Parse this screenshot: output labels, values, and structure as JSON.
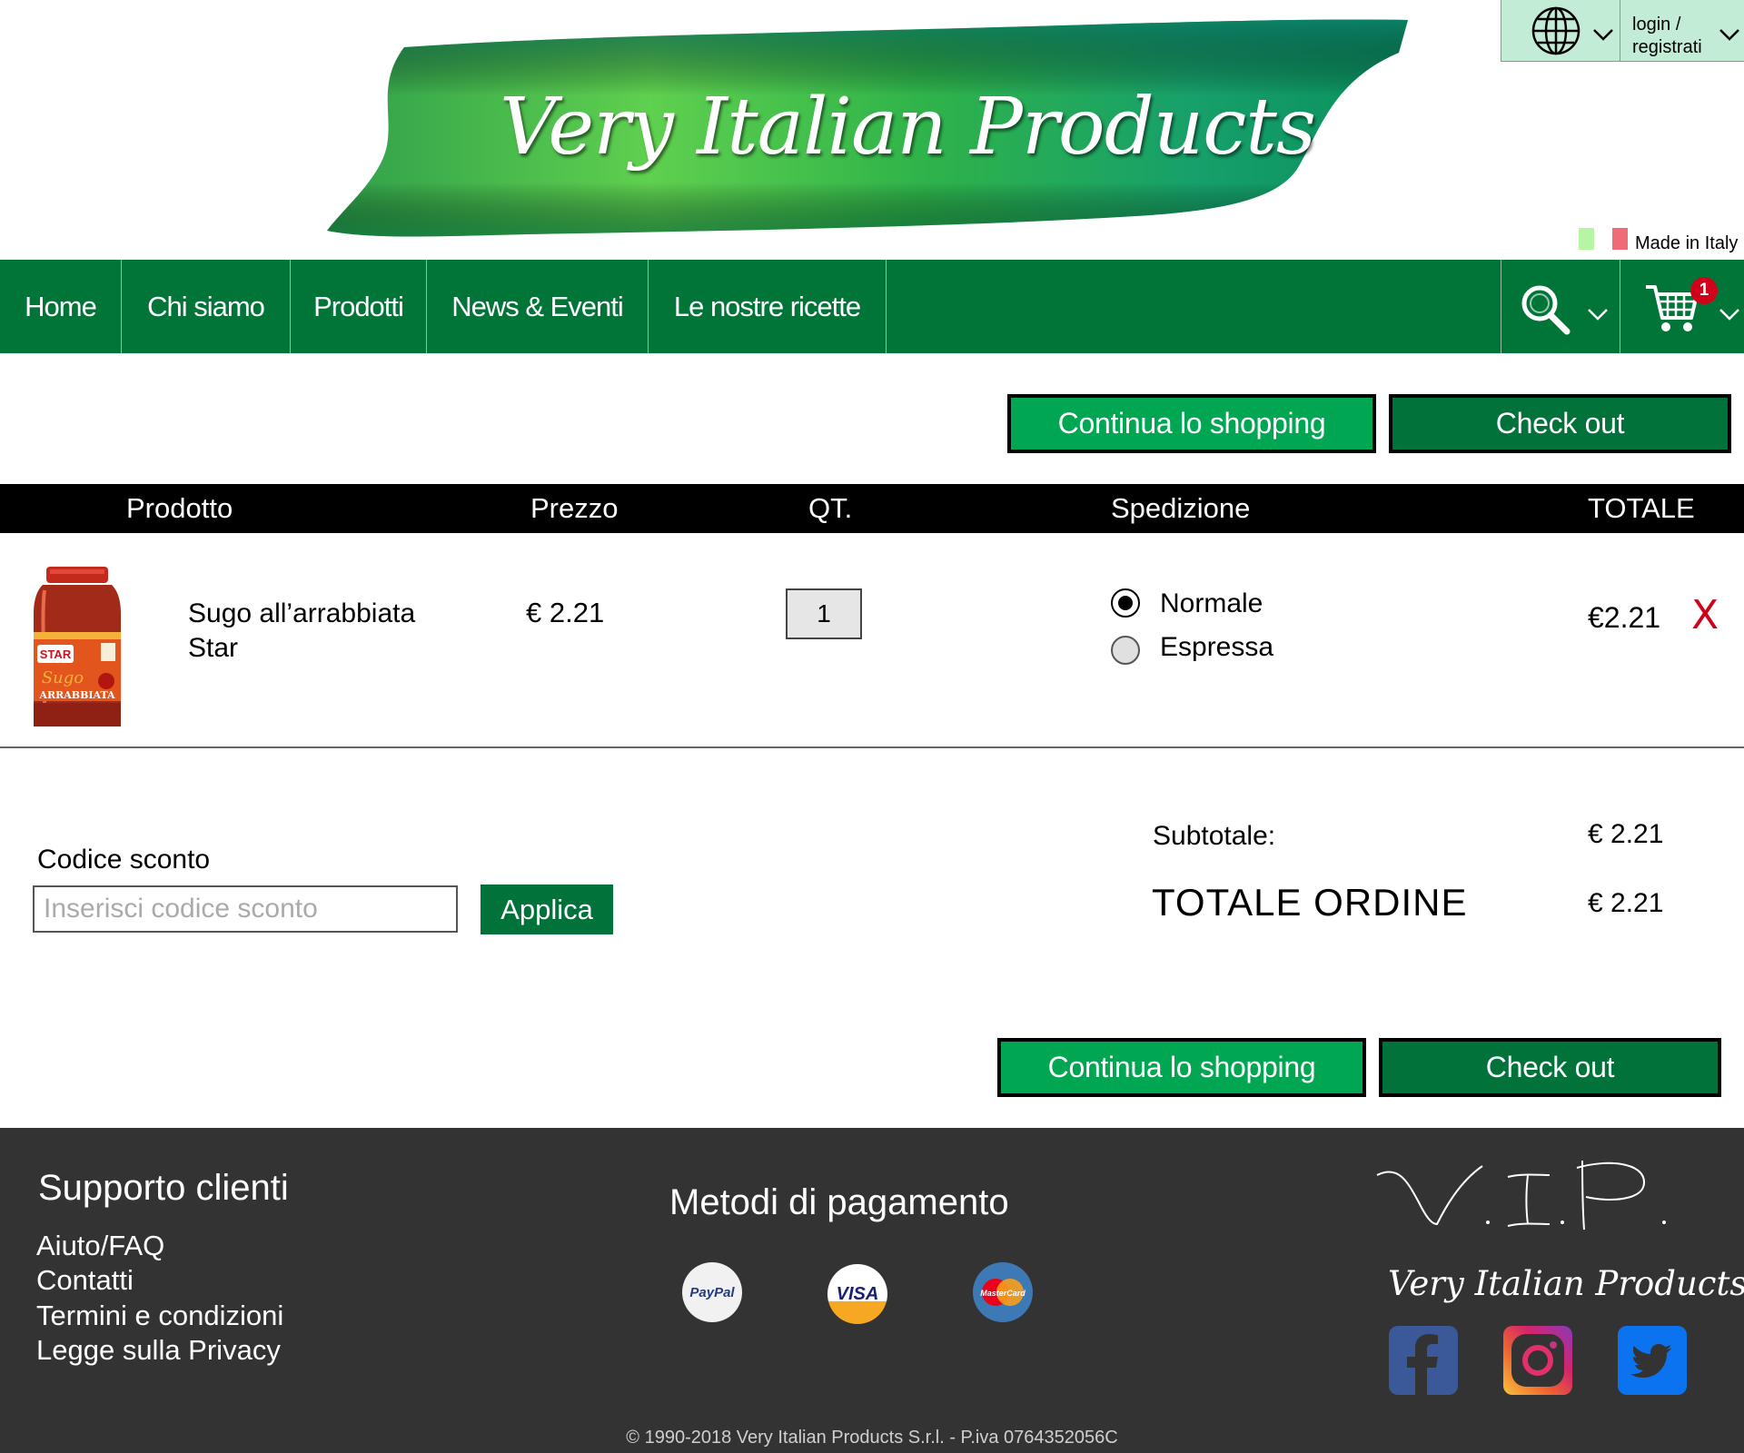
{
  "brand": {
    "logo_text": "Very Italian Products",
    "made_in": "Made in Italy",
    "colors": {
      "nav_green": "#017538",
      "button_light": "#00a651",
      "button_dark": "#01723a",
      "footer_bg": "#333333",
      "flag_green": "#b6f5a4",
      "flag_red": "#f06b78"
    }
  },
  "topbar": {
    "language_icon": "globe-icon",
    "login_label": "login / registrati"
  },
  "nav": {
    "items": [
      {
        "label": "Home"
      },
      {
        "label": "Chi siamo"
      },
      {
        "label": "Prodotti"
      },
      {
        "label": "News & Eventi"
      },
      {
        "label": "Le nostre ricette"
      }
    ],
    "search_icon": "search-icon",
    "cart_icon": "cart-icon",
    "cart_count": "1"
  },
  "actions": {
    "continue_label": "Continua lo shopping",
    "checkout_label": "Check out"
  },
  "cart_table": {
    "headers": {
      "product": "Prodotto",
      "price": "Prezzo",
      "qty": "QT.",
      "shipping": "Spedizione",
      "total": "TOTALE"
    },
    "rows": [
      {
        "product_name": "Sugo all’arrabbiata Star",
        "product_image_labels": {
          "brand": "STAR",
          "line": "Sugo",
          "variant": "ARRABBIATA"
        },
        "price": "€ 2.21",
        "qty": "1",
        "shipping_options": [
          {
            "label": "Normale",
            "selected": true
          },
          {
            "label": "Espressa",
            "selected": false
          }
        ],
        "total": "€2.21",
        "remove_label": "X"
      }
    ]
  },
  "discount": {
    "label": "Codice sconto",
    "placeholder": "Inserisci codice sconto",
    "value": "",
    "apply_label": "Applica"
  },
  "summary": {
    "subtotal_label": "Subtotale:",
    "subtotal_value": "€ 2.21",
    "total_label": "TOTALE ORDINE",
    "total_value": "€ 2.21"
  },
  "footer": {
    "support_title": "Supporto clienti",
    "support_links": [
      "Aiuto/FAQ",
      "Contatti",
      "Termini e condizioni",
      "Legge sulla Privacy"
    ],
    "payments_title": "Metodi di pagamento",
    "payment_methods": [
      {
        "name": "PayPal",
        "icon": "paypal-icon"
      },
      {
        "name": "VISA",
        "icon": "visa-icon"
      },
      {
        "name": "MasterCard",
        "icon": "mastercard-icon"
      }
    ],
    "vip_mark": "V.I.P.",
    "brand_name": "Very Italian Products",
    "social": [
      "facebook-icon",
      "instagram-icon",
      "twitter-icon"
    ],
    "copyright": "© 1990-2018 Very Italian Products S.r.l. - P.iva 0764352056C"
  }
}
